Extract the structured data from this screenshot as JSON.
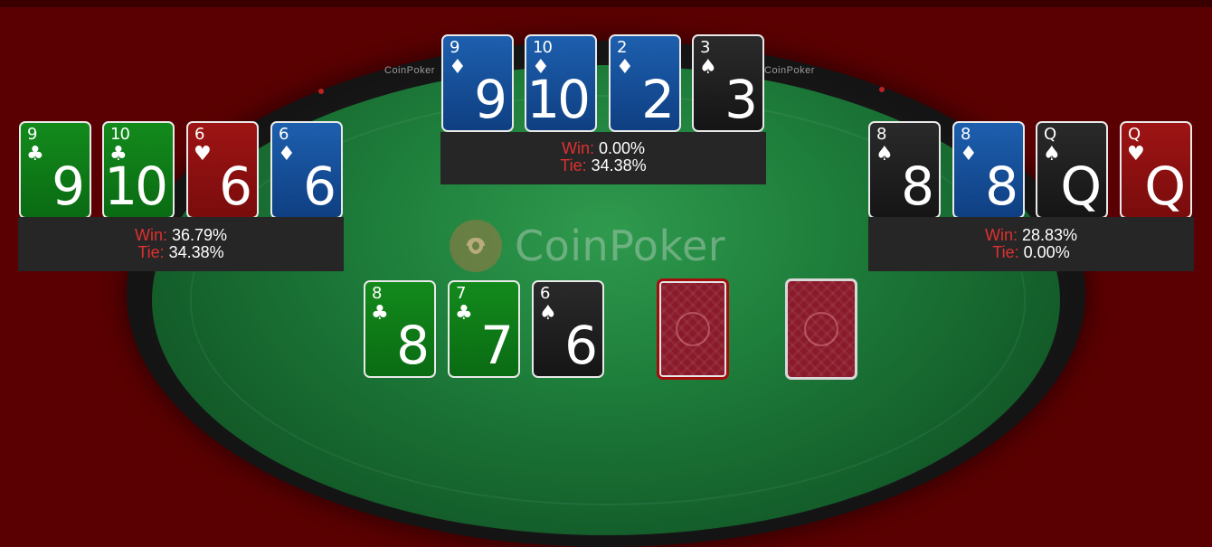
{
  "brand": {
    "name": "CoinPoker",
    "rail_text": "CoinPoker"
  },
  "colors": {
    "background": "#5a0002",
    "felt": "#1e7e3b",
    "label_red": "#e03030"
  },
  "hands": {
    "left": {
      "cards": [
        {
          "rank": "9",
          "suit": "♣",
          "color": "green"
        },
        {
          "rank": "10",
          "suit": "♣",
          "color": "green"
        },
        {
          "rank": "6",
          "suit": "♥",
          "color": "red"
        },
        {
          "rank": "6",
          "suit": "♦",
          "color": "blue"
        }
      ],
      "win_label": "Win:",
      "win": "36.79%",
      "tie_label": "Tie:",
      "tie": "34.38%"
    },
    "top": {
      "cards": [
        {
          "rank": "9",
          "suit": "♦",
          "color": "blue"
        },
        {
          "rank": "10",
          "suit": "♦",
          "color": "blue"
        },
        {
          "rank": "2",
          "suit": "♦",
          "color": "blue"
        },
        {
          "rank": "3",
          "suit": "♠",
          "color": "black"
        }
      ],
      "win_label": "Win:",
      "win": "0.00%",
      "tie_label": "Tie:",
      "tie": "34.38%"
    },
    "right": {
      "cards": [
        {
          "rank": "8",
          "suit": "♠",
          "color": "black"
        },
        {
          "rank": "8",
          "suit": "♦",
          "color": "blue"
        },
        {
          "rank": "Q",
          "suit": "♠",
          "color": "black"
        },
        {
          "rank": "Q",
          "suit": "♥",
          "color": "red"
        }
      ],
      "win_label": "Win:",
      "win": "28.83%",
      "tie_label": "Tie:",
      "tie": "0.00%"
    }
  },
  "board": {
    "cards": [
      {
        "rank": "8",
        "suit": "♣",
        "color": "green"
      },
      {
        "rank": "7",
        "suit": "♣",
        "color": "green"
      },
      {
        "rank": "6",
        "suit": "♠",
        "color": "black"
      }
    ],
    "face_down": [
      {
        "highlighted": true
      },
      {
        "highlighted": false
      }
    ]
  }
}
